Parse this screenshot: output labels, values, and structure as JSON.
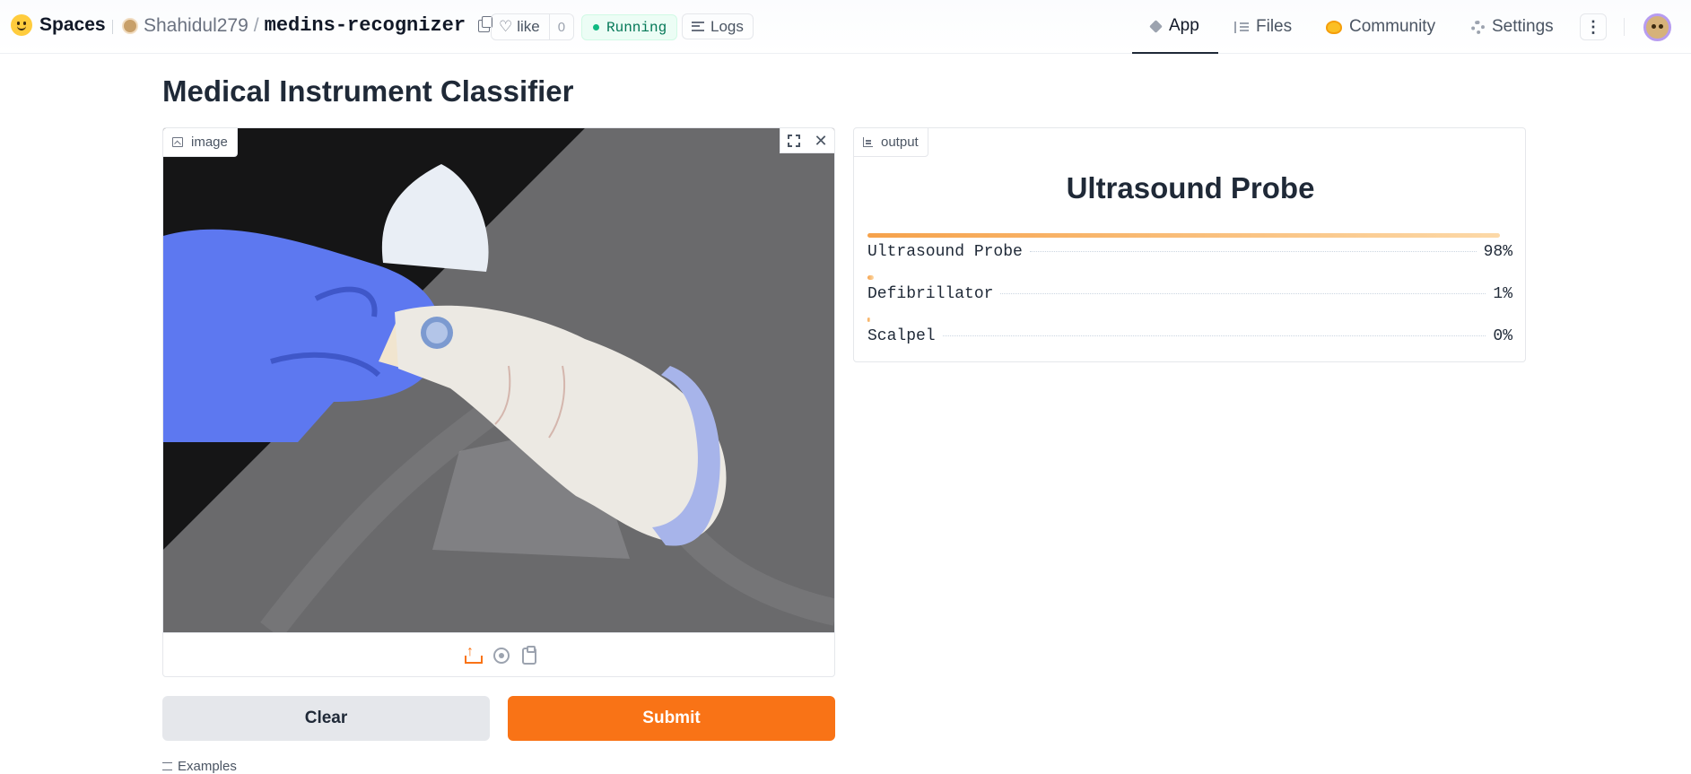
{
  "brand": {
    "name": "Spaces"
  },
  "repo": {
    "owner": "Shahidul279",
    "separator": "/",
    "name": "medins-recognizer"
  },
  "like": {
    "label": "like",
    "count": "0"
  },
  "status": {
    "label": "Running",
    "color": "#10b981"
  },
  "logs": {
    "label": "Logs"
  },
  "nav": {
    "app": "App",
    "files": "Files",
    "community": "Community",
    "settings": "Settings",
    "more": "⋮"
  },
  "page": {
    "title": "Medical Instrument Classifier"
  },
  "input": {
    "label": "image",
    "icons": [
      "image-icon",
      "expand-icon",
      "close-icon",
      "upload-icon",
      "webcam-icon",
      "clipboard-icon"
    ]
  },
  "buttons": {
    "clear": "Clear",
    "submit": "Submit"
  },
  "examples": {
    "label": "Examples"
  },
  "output": {
    "label": "output",
    "prediction": "Ultrasound Probe",
    "confidences": [
      {
        "label": "Ultrasound Probe",
        "percent": "98%",
        "fraction": 0.98
      },
      {
        "label": "Defibrillator",
        "percent": "1%",
        "fraction": 0.01
      },
      {
        "label": "Scalpel",
        "percent": "0%",
        "fraction": 0.003
      }
    ]
  },
  "colors": {
    "accent": "#f97316",
    "bar_start": "#f6a24b",
    "bar_end": "#fcd9a8",
    "clear_bg": "#e5e7eb"
  }
}
